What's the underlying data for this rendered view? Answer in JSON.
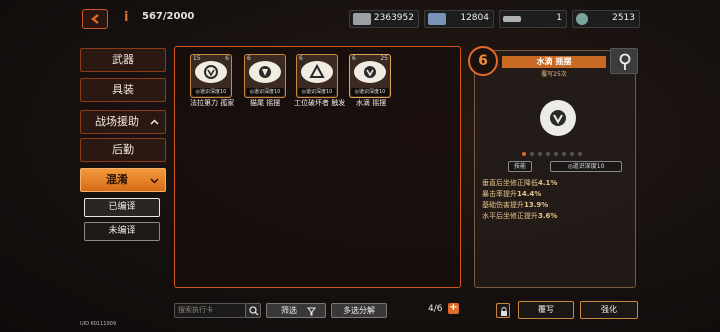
{
  "header": {
    "count": "567/2000"
  },
  "resources": [
    {
      "icon": "cash-icon",
      "value": "2363952",
      "color": "#9aa0a4"
    },
    {
      "icon": "crate-icon",
      "value": "12804",
      "color": "#7a93b8"
    },
    {
      "icon": "bullet-icon",
      "value": "1",
      "color": "#b0b0b0"
    },
    {
      "icon": "core-icon",
      "value": "2513",
      "color": "#7aa39a"
    }
  ],
  "menu": {
    "items": [
      "武器",
      "具装",
      "战场援助",
      "后勤",
      "混淆"
    ],
    "selected": "混淆",
    "sub_items": [
      "已编译",
      "未编译"
    ],
    "sub_selected": "已编译"
  },
  "cards": [
    {
      "level": "15",
      "count": "6",
      "tag": "◎道识深度10",
      "name": "法拉第力 孤家"
    },
    {
      "level": "6",
      "count": "",
      "tag": "◎道识深度10",
      "name": "猫尾 摇摆"
    },
    {
      "level": "6",
      "count": "",
      "tag": "◎道识深度10",
      "name": "工位破坏者 触发"
    },
    {
      "level": "6",
      "count": "25",
      "tag": "◎道识深度10",
      "name": "水滴 摇摆"
    }
  ],
  "detail": {
    "star": "6",
    "title": "水滴 摇摆",
    "subtitle": "覆写25次",
    "skill_button": "技能",
    "depth_tag": "◎道识深度10",
    "stats": [
      {
        "label": "垂直后坐修正降低",
        "value": "4.1%"
      },
      {
        "label": "暴击率提升",
        "value": "14.4%"
      },
      {
        "label": "基础伤害提升",
        "value": "13.9%"
      },
      {
        "label": "水平后坐修正提升",
        "value": "3.6%"
      }
    ]
  },
  "bottom": {
    "search_placeholder": "搜索执行卡",
    "filter_label": "筛选",
    "multi_label": "多选分解",
    "pager": "4/6",
    "rewrite_label": "覆写",
    "enhance_label": "强化",
    "uid": "UID 60111009"
  }
}
